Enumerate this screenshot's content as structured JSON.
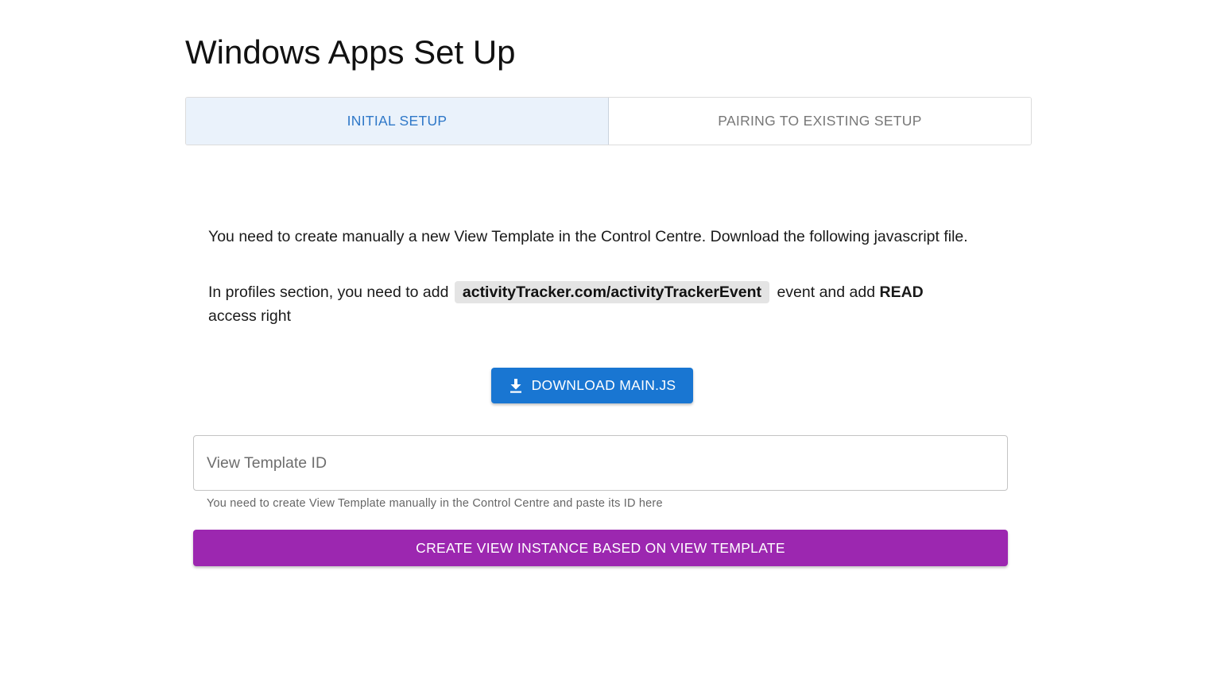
{
  "page": {
    "title": "Windows Apps Set Up"
  },
  "tabs": [
    {
      "label": "INITIAL SETUP",
      "active": true
    },
    {
      "label": "PAIRING TO EXISTING SETUP",
      "active": false
    }
  ],
  "instructions": {
    "paragraph1": "You need to create manually a new View Template in the Control Centre. Download the following javascript file.",
    "paragraph2_prefix": "In profiles section, you need to add",
    "event_code": "activityTracker.com/activityTrackerEvent",
    "paragraph2_middle": "event and add",
    "access_right": "READ",
    "paragraph2_suffix": "access right"
  },
  "download_button": {
    "label": "DOWNLOAD MAIN.JS",
    "icon": "download-icon"
  },
  "view_template_field": {
    "placeholder": "View Template ID",
    "value": "",
    "helper_text": "You need to create View Template manually in the Control Centre and paste its ID here"
  },
  "create_button": {
    "label": "CREATE VIEW INSTANCE BASED ON VIEW TEMPLATE"
  },
  "colors": {
    "primary": "#1976d2",
    "secondary": "#9c27b0",
    "active_tab_background": "#eaf2fb",
    "active_tab_text": "#2f78c8"
  }
}
